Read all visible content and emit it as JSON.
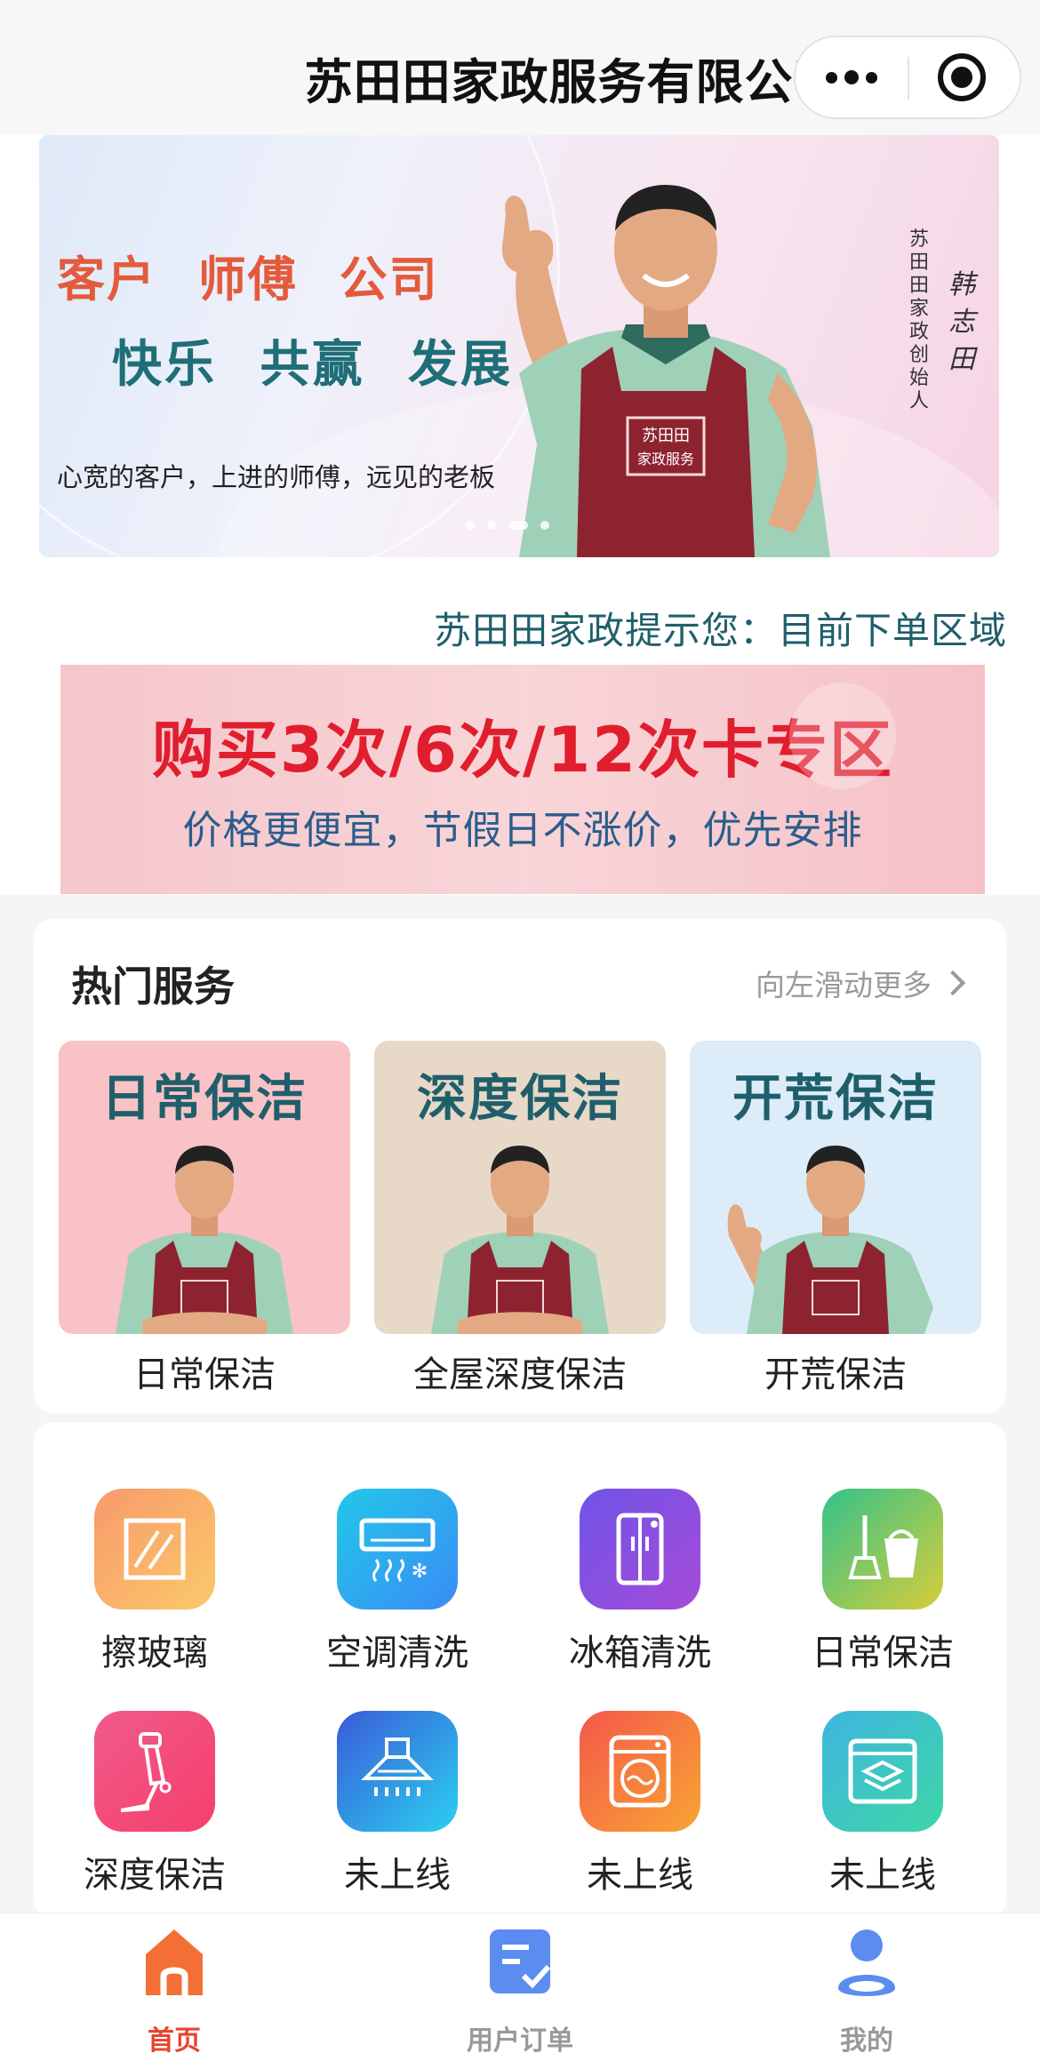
{
  "header": {
    "title": "苏田田家政服务有限公司",
    "more_icon": "more-dots-icon",
    "close_icon": "target-icon"
  },
  "banner": {
    "line1": "客户 师傅 公司",
    "line2": "快乐 共赢 发展",
    "line3": "心宽的客户，上进的师傅，远见的老板",
    "vertical_text": "苏田田家政创始人",
    "signature": "韩志田",
    "apron_text": "苏田田家政服务",
    "slides": 4,
    "active_slide": 3
  },
  "notice": {
    "text": "苏田田家政提示您：目前下单区域"
  },
  "promo": {
    "title": "购买3次/6次/12次卡专区",
    "subtitle": "价格更便宜，节假日不涨价，优先安排"
  },
  "hot_services": {
    "title": "热门服务",
    "more": "向左滑动更多",
    "items": [
      {
        "image_text": "日常保洁",
        "label": "日常保洁",
        "bg": "#f9c2c6"
      },
      {
        "image_text": "深度保洁",
        "label": "全屋深度保洁",
        "bg": "#e8d8c8"
      },
      {
        "image_text": "开荒保洁",
        "label": "开荒保洁",
        "bg": "#dcecf8"
      }
    ]
  },
  "grid": {
    "items": [
      {
        "label": "擦玻璃",
        "icon": "window-glass-icon"
      },
      {
        "label": "空调清洗",
        "icon": "air-conditioner-icon"
      },
      {
        "label": "冰箱清洗",
        "icon": "refrigerator-icon"
      },
      {
        "label": "日常保洁",
        "icon": "broom-bucket-icon"
      },
      {
        "label": "深度保洁",
        "icon": "vacuum-cleaner-icon"
      },
      {
        "label": "未上线",
        "icon": "range-hood-icon"
      },
      {
        "label": "未上线",
        "icon": "washing-machine-icon"
      },
      {
        "label": "未上线",
        "icon": "layers-box-icon"
      }
    ]
  },
  "tabbar": {
    "items": [
      {
        "label": "首页",
        "icon": "home-icon",
        "active": true
      },
      {
        "label": "用户订单",
        "icon": "order-icon",
        "active": false
      },
      {
        "label": "我的",
        "icon": "user-icon",
        "active": false
      }
    ]
  },
  "colors": {
    "accent": "#e8442d",
    "teal_text": "#1f5f6b",
    "promo_red": "#e01e2e"
  }
}
